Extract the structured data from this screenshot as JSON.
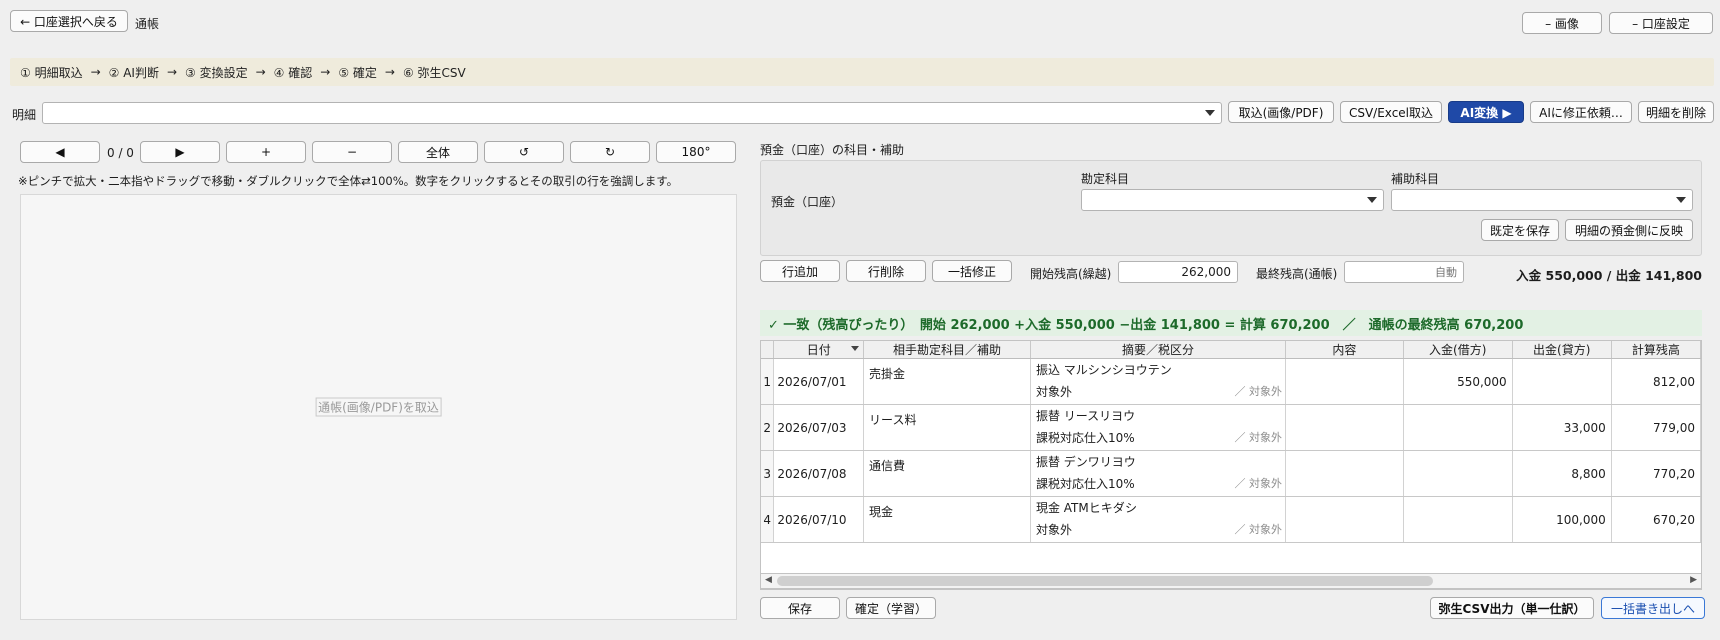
{
  "header": {
    "back_label": "← 口座選択へ戻る",
    "title": "通帳",
    "image_label": "– 画像",
    "settings_label": "– 口座設定"
  },
  "steps": [
    "① 明細取込",
    "② AI判断",
    "③ 変換設定",
    "④ 確認",
    "⑤ 確定",
    "⑥ 弥生CSV"
  ],
  "step_arrow": "→",
  "detail_bar": {
    "label": "明細",
    "import_image_pdf": "取込(画像/PDF)",
    "import_csv_excel": "CSV/Excel取込",
    "ai_convert": "AI変換 ▶",
    "ai_fix": "AIに修正依頼…",
    "delete_detail": "明細を削除"
  },
  "viewer": {
    "prev": "◀",
    "page": "0 / 0",
    "next": "▶",
    "zoom_in": "+",
    "zoom_out": "−",
    "fit": "全体",
    "rotate_left": "↺",
    "rotate_right": "↻",
    "rotate_180": "180°",
    "hint": "※ピンチで拡大・二本指やドラッグで移動・ダブルクリックで全体⇄100%。数字をクリックするとその取引の行を強調します。",
    "placeholder": "通帳(画像/PDF)を取込"
  },
  "account_panel": {
    "section_title": "預金（口座）の科目・補助",
    "row_label": "預金（口座）",
    "account_label": "勘定科目",
    "sub_account_label": "補助科目",
    "account_value": "",
    "sub_account_value": "",
    "save_default": "既定を保存",
    "apply_to_deposit": "明細の預金側に反映"
  },
  "actions": {
    "add_row": "行追加",
    "delete_row": "行削除",
    "bulk_edit": "一括修正",
    "opening_label": "開始残高(繰越)",
    "opening_value": "262,000",
    "closing_label": "最終残高(通帳)",
    "closing_placeholder": "自動",
    "totals": "入金 550,000 / 出金 141,800"
  },
  "summary": "✓ 一致（残高ぴったり）　開始 262,000 +入金 550,000 −出金 141,800 = 計算 670,200　／　通帳の最終残高 670,200",
  "table": {
    "headers": [
      "日付",
      "相手勘定科目／補助",
      "摘要／税区分",
      "内容",
      "入金(借方)",
      "出金(貸方)",
      "計算残高"
    ],
    "rows": [
      {
        "no": "1",
        "date": "2026/07/01",
        "account": "売掛金",
        "desc": "振込 マルシンシヨウテン",
        "tax": "対象外",
        "tax_note": "／ 対象外",
        "content": "",
        "deposit": "550,000",
        "withdrawal": "",
        "balance": "812,00"
      },
      {
        "no": "2",
        "date": "2026/07/03",
        "account": "リース料",
        "desc": "振替 リースリヨウ",
        "tax": "課税対応仕入10%",
        "tax_note": "／ 対象外",
        "content": "",
        "deposit": "",
        "withdrawal": "33,000",
        "balance": "779,00"
      },
      {
        "no": "3",
        "date": "2026/07/08",
        "account": "通信費",
        "desc": "振替 デンワリヨウ",
        "tax": "課税対応仕入10%",
        "tax_note": "／ 対象外",
        "content": "",
        "deposit": "",
        "withdrawal": "8,800",
        "balance": "770,20"
      },
      {
        "no": "4",
        "date": "2026/07/10",
        "account": "現金",
        "desc": "現金 ATMヒキダシ",
        "tax": "対象外",
        "tax_note": "／ 対象外",
        "content": "",
        "deposit": "",
        "withdrawal": "100,000",
        "balance": "670,20"
      }
    ]
  },
  "footer": {
    "save": "保存",
    "confirm_learn": "確定（学習）",
    "yayoi_export": "弥生CSV出力（単一仕訳）",
    "bulk_export": "一括書き出しへ"
  },
  "colors": {
    "primary": "#1f49a7",
    "success_bg": "#e3f1e4",
    "success_text": "#1d6a2a",
    "steps_bg": "#efebdc"
  }
}
